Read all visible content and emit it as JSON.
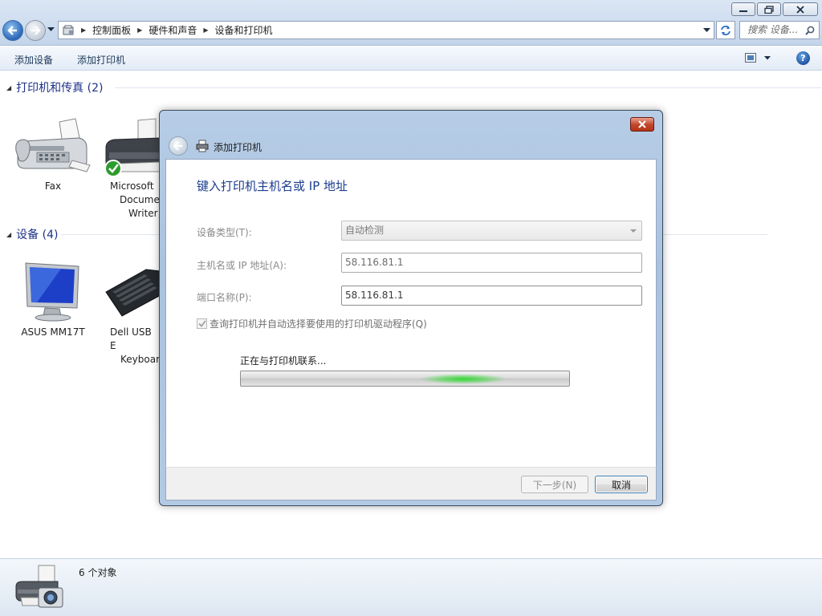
{
  "window": {
    "buttons": [
      "minimize-icon",
      "restore-icon",
      "close-icon"
    ]
  },
  "address_bar": {
    "breadcrumb": [
      "控制面板",
      "硬件和声音",
      "设备和打印机"
    ],
    "search_placeholder": "搜索 设备..."
  },
  "toolbar": {
    "add_device": "添加设备",
    "add_printer": "添加打印机"
  },
  "groups": {
    "printers": {
      "title": "打印机和传真 (2)",
      "items": [
        {
          "name": "Fax",
          "icon": "fax-icon"
        },
        {
          "line1": "Microsoft ",
          "line2": "Docume",
          "line3": "Writer",
          "icon": "printer-icon",
          "status": "default"
        }
      ]
    },
    "devices": {
      "title": "设备 (4)",
      "items": [
        {
          "name": "ASUS MM17T",
          "icon": "monitor-icon"
        },
        {
          "line1": "Dell USB E",
          "line2": "Keyboar",
          "icon": "keyboard-icon"
        }
      ]
    }
  },
  "statusbar": {
    "count": "6 个对象"
  },
  "dialog": {
    "title": "添加打印机",
    "heading": "键入打印机主机名或 IP 地址",
    "fields": {
      "device_type_label": "设备类型(T):",
      "device_type_value": "自动检测",
      "hostname_label": "主机名或 IP 地址(A):",
      "hostname_value": "58.116.81.1",
      "port_label": "端口名称(P):",
      "port_value": "58.116.81.1"
    },
    "checkbox_label": "查询打印机并自动选择要使用的打印机驱动程序(Q)",
    "checkbox_checked": true,
    "progress_label": "正在与打印机联系...",
    "buttons": {
      "next": "下一步(N)",
      "cancel": "取消"
    }
  },
  "colors": {
    "heading": "#1b3d8f",
    "group_title": "#1e3287",
    "progress_glow": "#36d736"
  }
}
